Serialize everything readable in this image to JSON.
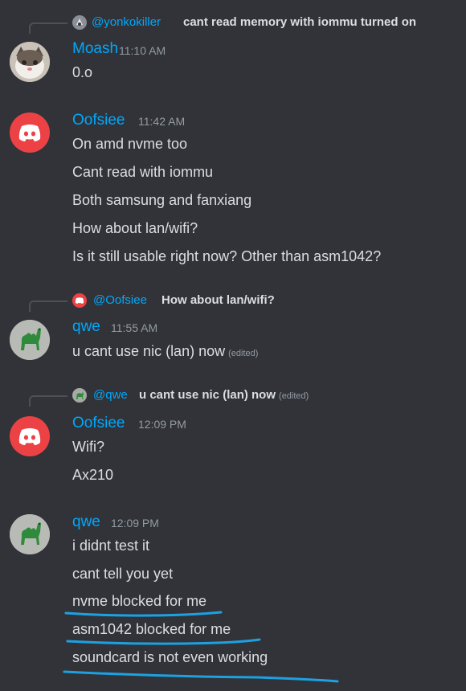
{
  "groups": [
    {
      "reply": {
        "username": "@yonkokiller",
        "text": "cant read memory with iommu turned on"
      },
      "author": "Moash",
      "time": "11:10 AM",
      "avatar_icon": "cat-avatar",
      "lines": [
        "0.o"
      ]
    },
    {
      "author": "Oofsiee",
      "time": "11:42 AM",
      "avatar_icon": "discord-logo-avatar",
      "lines": [
        "On amd nvme too",
        "Cant read with iommu",
        "Both samsung and fanxiang",
        "How about lan/wifi?",
        "Is it still usable right now? Other than asm1042?"
      ]
    },
    {
      "reply": {
        "username": "@Oofsiee",
        "text": "How about lan/wifi?"
      },
      "author": "qwe",
      "time": "11:55 AM",
      "avatar_icon": "camel-avatar",
      "lines": [
        "u cant use nic (lan) now"
      ],
      "edited": "(edited)"
    },
    {
      "reply": {
        "username": "@qwe",
        "text": "u cant use nic (lan) now",
        "edited": "(edited)"
      },
      "author": "Oofsiee",
      "time": "12:09 PM",
      "avatar_icon": "discord-logo-avatar",
      "lines": [
        "Wifi?",
        "Ax210"
      ]
    },
    {
      "author": "qwe",
      "time": "12:09 PM",
      "avatar_icon": "camel-avatar",
      "lines": [
        "i didnt test it",
        "cant tell you yet",
        "nvme blocked for me",
        "asm1042 blocked for me",
        "soundcard is not even working"
      ]
    }
  ],
  "colors": {
    "background": "#313338",
    "username": "#00a8fc",
    "text": "#dbdee1",
    "timestamp": "#949ba4",
    "discord_red": "#ed4245",
    "annotation_underline": "#1da1e2"
  }
}
